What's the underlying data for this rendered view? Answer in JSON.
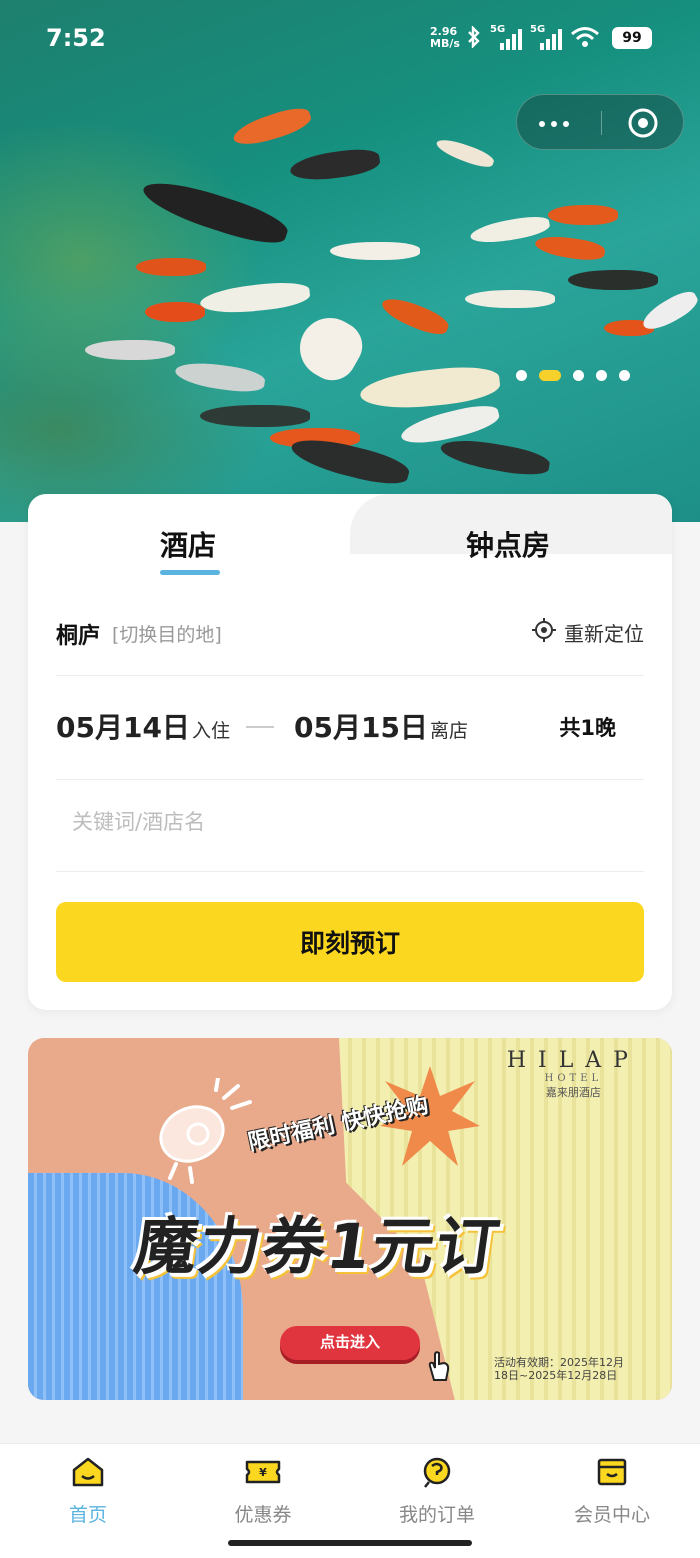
{
  "status_bar": {
    "time": "7:52",
    "net_speed_top": "2.96",
    "net_speed_bottom": "MB/s",
    "signal_1": "5G",
    "signal_2": "5G",
    "battery": "99"
  },
  "carousel": {
    "total": 5,
    "active_index": 1
  },
  "tabs": {
    "hotel": "酒店",
    "hourly": "钟点房",
    "active": "hotel"
  },
  "search": {
    "city": "桐庐",
    "switch_label": "[切换目的地]",
    "relocate_label": "重新定位",
    "checkin_date": "05月14日",
    "checkin_label": "入住",
    "checkout_date": "05月15日",
    "checkout_label": "离店",
    "nights": "共1晚",
    "keyword_value": "",
    "keyword_placeholder": "关键词/酒店名",
    "book_button": "即刻预订"
  },
  "banner": {
    "brand": "HILAP",
    "brand_sub": "HOTEL",
    "brand_cn": "嘉来朋酒店",
    "tag": "限时福利 快快抢购",
    "headline": "魔力券1元订",
    "button": "点击进入",
    "validity_line1": "活动有效期：2025年12月",
    "validity_line2": "18日~2025年12月28日"
  },
  "nav": [
    {
      "label": "首页",
      "icon": "home-icon",
      "active": true
    },
    {
      "label": "优惠券",
      "icon": "coupon-icon",
      "active": false
    },
    {
      "label": "我的订单",
      "icon": "orders-icon",
      "active": false
    },
    {
      "label": "会员中心",
      "icon": "member-icon",
      "active": false
    }
  ],
  "colors": {
    "accent": "#5bb3e0",
    "cta": "#fcd71f",
    "banner_button": "#e0353f"
  }
}
